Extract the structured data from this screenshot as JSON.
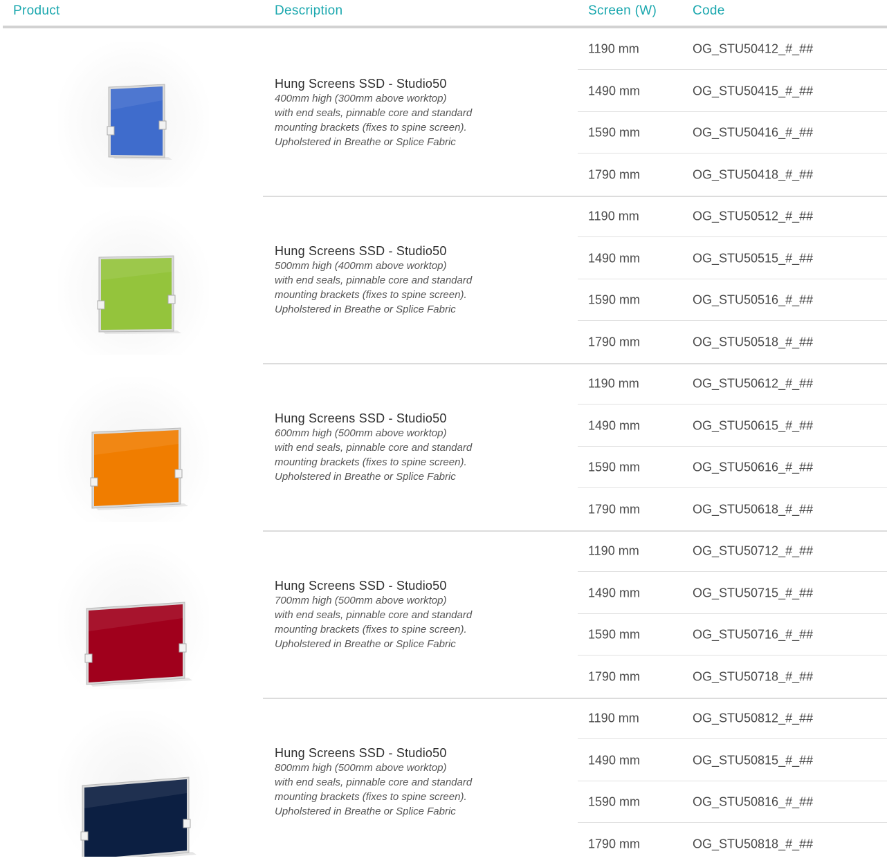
{
  "header": {
    "product": "Product",
    "description": "Description",
    "screen": "Screen (W)",
    "code": "Code"
  },
  "colors": {
    "accent": "#1aa7ae",
    "panels": [
      "#3f6ccc",
      "#94c43c",
      "#f07d00",
      "#a0001c",
      "#0c1f42"
    ]
  },
  "groups": [
    {
      "title": "Hung Screens SSD - Studio50",
      "lines": [
        "400mm high (300mm above worktop)",
        "with end seals, pinnable core and standard",
        "mounting brackets (fixes to spine screen).",
        "Upholstered in Breathe or Splice Fabric"
      ],
      "rows": [
        {
          "width": "1190 mm",
          "code": "OG_STU50412_#_##"
        },
        {
          "width": "1490 mm",
          "code": "OG_STU50415_#_##"
        },
        {
          "width": "1590 mm",
          "code": "OG_STU50416_#_##"
        },
        {
          "width": "1790 mm",
          "code": "OG_STU50418_#_##"
        }
      ]
    },
    {
      "title": "Hung Screens SSD - Studio50",
      "lines": [
        "500mm high (400mm above worktop)",
        "with end seals, pinnable core and standard",
        "mounting brackets (fixes to spine screen).",
        "Upholstered in Breathe or Splice Fabric"
      ],
      "rows": [
        {
          "width": "1190 mm",
          "code": "OG_STU50512_#_##"
        },
        {
          "width": "1490 mm",
          "code": "OG_STU50515_#_##"
        },
        {
          "width": "1590 mm",
          "code": "OG_STU50516_#_##"
        },
        {
          "width": "1790 mm",
          "code": "OG_STU50518_#_##"
        }
      ]
    },
    {
      "title": "Hung Screens SSD - Studio50",
      "lines": [
        "600mm high (500mm above worktop)",
        "with end seals, pinnable core and standard",
        "mounting brackets (fixes to spine screen).",
        "Upholstered in Breathe or Splice Fabric"
      ],
      "rows": [
        {
          "width": "1190 mm",
          "code": "OG_STU50612_#_##"
        },
        {
          "width": "1490 mm",
          "code": "OG_STU50615_#_##"
        },
        {
          "width": "1590 mm",
          "code": "OG_STU50616_#_##"
        },
        {
          "width": "1790 mm",
          "code": "OG_STU50618_#_##"
        }
      ]
    },
    {
      "title": "Hung Screens SSD - Studio50",
      "lines": [
        "700mm high (500mm above worktop)",
        "with end seals, pinnable core and standard",
        "mounting brackets (fixes to spine screen).",
        "Upholstered in Breathe or Splice Fabric"
      ],
      "rows": [
        {
          "width": "1190 mm",
          "code": "OG_STU50712_#_##"
        },
        {
          "width": "1490 mm",
          "code": "OG_STU50715_#_##"
        },
        {
          "width": "1590 mm",
          "code": "OG_STU50716_#_##"
        },
        {
          "width": "1790 mm",
          "code": "OG_STU50718_#_##"
        }
      ]
    },
    {
      "title": "Hung Screens SSD - Studio50",
      "lines": [
        "800mm high (500mm above worktop)",
        "with end seals, pinnable core and standard",
        "mounting brackets (fixes to spine screen).",
        "Upholstered in Breathe or Splice Fabric"
      ],
      "rows": [
        {
          "width": "1190 mm",
          "code": "OG_STU50812_#_##"
        },
        {
          "width": "1490 mm",
          "code": "OG_STU50815_#_##"
        },
        {
          "width": "1590 mm",
          "code": "OG_STU50816_#_##"
        },
        {
          "width": "1790 mm",
          "code": "OG_STU50818_#_##"
        }
      ]
    }
  ]
}
